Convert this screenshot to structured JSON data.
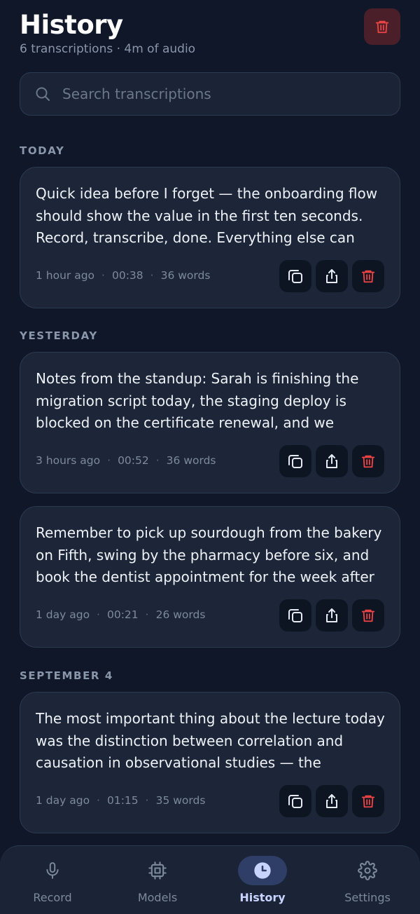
{
  "header": {
    "title": "History",
    "subtitle": "6 transcriptions · 4m of audio"
  },
  "search": {
    "placeholder": "Search transcriptions"
  },
  "sections": [
    {
      "label": "TODAY"
    },
    {
      "label": "YESTERDAY"
    },
    {
      "label": "SEPTEMBER 4"
    }
  ],
  "cards": [
    {
      "text": "Quick idea before I forget — the onboarding flow should show the value in the first ten seconds. Record, transcribe, done. Everything else can wait…",
      "time": "1 hour ago",
      "duration": "00:38",
      "words": "36 words"
    },
    {
      "text": "Notes from the standup: Sarah is finishing the migration script today, the staging deploy is blocked on the certificate renewal, and we agreed…",
      "time": "3 hours ago",
      "duration": "00:52",
      "words": "36 words"
    },
    {
      "text": "Remember to pick up sourdough from the bakery on Fifth, swing by the pharmacy before six, and book the dentist appointment for the week after …",
      "time": "1 day ago",
      "duration": "00:21",
      "words": "26 words"
    },
    {
      "text": "The most important thing about the lecture today was the distinction between correlation and causation in observational studies — the professo…",
      "time": "1 day ago",
      "duration": "01:15",
      "words": "35 words"
    }
  ],
  "meta_separator": "·",
  "tabs": [
    {
      "label": "Record",
      "icon": "microphone-icon"
    },
    {
      "label": "Models",
      "icon": "chip-icon"
    },
    {
      "label": "History",
      "icon": "clock-icon"
    },
    {
      "label": "Settings",
      "icon": "gear-icon"
    }
  ],
  "active_tab": "History",
  "colors": {
    "background": "#0f1729",
    "card": "#1c2638",
    "accent": "#c9d3ff",
    "danger": "#ef4444"
  }
}
